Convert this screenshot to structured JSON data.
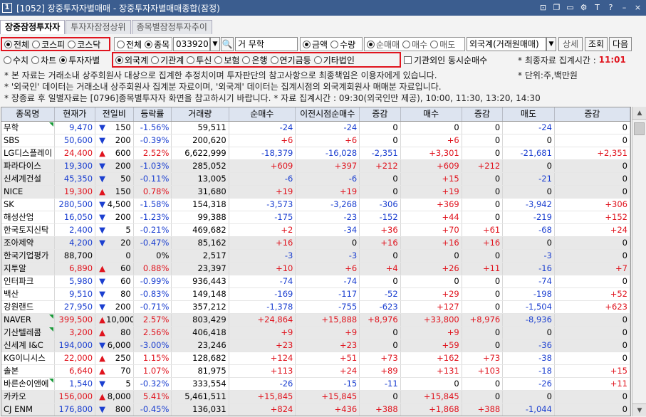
{
  "window": {
    "number": "1",
    "title": "[1052] 장중투자자별매매 - 장중투자자별매매종합(잠정)"
  },
  "tabs": [
    "장중잠정투자자",
    "투자자잠정상위",
    "종목별잠정투자추이"
  ],
  "market_radios": [
    "전체",
    "코스피",
    "코스닥"
  ],
  "scope_radios": [
    "전체",
    "종목"
  ],
  "stock_code": "033920",
  "stock_name_prefix": "거",
  "stock_name": "무학",
  "amount_radios": [
    "금액",
    "수량"
  ],
  "net_radios": [
    "순매매",
    "매수",
    "매도"
  ],
  "investor_select": "외국계(거래원매매)",
  "buttons": {
    "detail": "상세",
    "query": "조회",
    "next": "다음"
  },
  "type_radios": [
    "수치",
    "차트",
    "투자자별"
  ],
  "investor_radios": [
    "외국계",
    "기관계",
    "투신",
    "보험",
    "은행",
    "연기금등",
    "기타법인"
  ],
  "checkbox_label": "기관외인 동시순매수",
  "last_time_label": "* 최종자료 집계시간 :",
  "last_time": "11:01",
  "unit": "* 단위:주,백만원",
  "notes": [
    "* 본 자료는 거래소내 상주회원사 대상으로 집계한 추정치이며 투자판단의 참고사항으로 최종책임은 이용자에게 있습니다.",
    "* '외국인' 데이터는 거래소내 상주회원사 집계분 자료이며, '외국계' 데이터는 집계시점의 외국계회원사 매매분 자료입니다.",
    "* 장종료 후 일별자료는 [0796]종목별투자자 화면을 참고하시기 바랍니다.  * 자료 집계시간 : 09:30(외국인만 제공), 10:00, 11:30, 13:20, 14:30"
  ],
  "columns": [
    "종목명",
    "현재가",
    "전일비",
    "등락률",
    "거래량",
    "순매수",
    "이전시점순매수",
    "증감",
    "매수",
    "증감",
    "매도",
    "증감"
  ],
  "rows": [
    {
      "name": "무학",
      "price": "9,470",
      "dir": "dn",
      "chg": "150",
      "rate": "-1.56%",
      "vol": "59,511",
      "net": "-24",
      "prev": "-24",
      "d1": "0",
      "buy": "0",
      "d2": "0",
      "sell": "-24",
      "d3": "0",
      "mark": true,
      "gray": false
    },
    {
      "name": "SBS",
      "price": "50,600",
      "dir": "dn",
      "chg": "200",
      "rate": "-0.39%",
      "vol": "200,620",
      "net": "+6",
      "prev": "+6",
      "d1": "0",
      "buy": "+6",
      "d2": "0",
      "sell": "0",
      "d3": "0",
      "mark": false,
      "gray": false
    },
    {
      "name": "LG디스플레이",
      "price": "24,400",
      "dir": "up",
      "chg": "600",
      "rate": "2.52%",
      "vol": "6,622,999",
      "net": "-18,379",
      "prev": "-16,028",
      "d1": "-2,351",
      "buy": "+3,301",
      "d2": "0",
      "sell": "-21,681",
      "d3": "+2,351",
      "mark": false,
      "gray": false
    },
    {
      "name": "파라다이스",
      "price": "19,300",
      "dir": "dn",
      "chg": "200",
      "rate": "-1.03%",
      "vol": "285,052",
      "net": "+609",
      "prev": "+397",
      "d1": "+212",
      "buy": "+609",
      "d2": "+212",
      "sell": "0",
      "d3": "0",
      "mark": false,
      "gray": true
    },
    {
      "name": "신세계건설",
      "price": "45,350",
      "dir": "dn",
      "chg": "50",
      "rate": "-0.11%",
      "vol": "13,005",
      "net": "-6",
      "prev": "-6",
      "d1": "0",
      "buy": "+15",
      "d2": "0",
      "sell": "-21",
      "d3": "0",
      "mark": false,
      "gray": true
    },
    {
      "name": "NICE",
      "price": "19,300",
      "dir": "up",
      "chg": "150",
      "rate": "0.78%",
      "vol": "31,680",
      "net": "+19",
      "prev": "+19",
      "d1": "0",
      "buy": "+19",
      "d2": "0",
      "sell": "0",
      "d3": "0",
      "mark": false,
      "gray": true
    },
    {
      "name": "SK",
      "price": "280,500",
      "dir": "dn",
      "chg": "4,500",
      "rate": "-1.58%",
      "vol": "154,318",
      "net": "-3,573",
      "prev": "-3,268",
      "d1": "-306",
      "buy": "+369",
      "d2": "0",
      "sell": "-3,942",
      "d3": "+306",
      "mark": false,
      "gray": false
    },
    {
      "name": "해성산업",
      "price": "16,050",
      "dir": "dn",
      "chg": "200",
      "rate": "-1.23%",
      "vol": "99,388",
      "net": "-175",
      "prev": "-23",
      "d1": "-152",
      "buy": "+44",
      "d2": "0",
      "sell": "-219",
      "d3": "+152",
      "mark": false,
      "gray": false
    },
    {
      "name": "한국토지신탁",
      "price": "2,400",
      "dir": "dn",
      "chg": "5",
      "rate": "-0.21%",
      "vol": "469,682",
      "net": "+2",
      "prev": "-34",
      "d1": "+36",
      "buy": "+70",
      "d2": "+61",
      "sell": "-68",
      "d3": "+24",
      "mark": false,
      "gray": false
    },
    {
      "name": "조아제약",
      "price": "4,200",
      "dir": "dn",
      "chg": "20",
      "rate": "-0.47%",
      "vol": "85,162",
      "net": "+16",
      "prev": "0",
      "d1": "+16",
      "buy": "+16",
      "d2": "+16",
      "sell": "0",
      "d3": "0",
      "mark": false,
      "gray": true
    },
    {
      "name": "한국기업평가",
      "price": "88,700",
      "dir": "",
      "chg": "0",
      "rate": "0%",
      "vol": "2,517",
      "net": "-3",
      "prev": "-3",
      "d1": "0",
      "buy": "0",
      "d2": "0",
      "sell": "-3",
      "d3": "0",
      "mark": false,
      "gray": true
    },
    {
      "name": "지투알",
      "price": "6,890",
      "dir": "up",
      "chg": "60",
      "rate": "0.88%",
      "vol": "23,397",
      "net": "+10",
      "prev": "+6",
      "d1": "+4",
      "buy": "+26",
      "d2": "+11",
      "sell": "-16",
      "d3": "+7",
      "mark": false,
      "gray": true
    },
    {
      "name": "인터파크",
      "price": "5,980",
      "dir": "dn",
      "chg": "60",
      "rate": "-0.99%",
      "vol": "936,443",
      "net": "-74",
      "prev": "-74",
      "d1": "0",
      "buy": "0",
      "d2": "0",
      "sell": "-74",
      "d3": "0",
      "mark": false,
      "gray": false
    },
    {
      "name": "백산",
      "price": "9,510",
      "dir": "dn",
      "chg": "80",
      "rate": "-0.83%",
      "vol": "149,148",
      "net": "-169",
      "prev": "-117",
      "d1": "-52",
      "buy": "+29",
      "d2": "0",
      "sell": "-198",
      "d3": "+52",
      "mark": false,
      "gray": false
    },
    {
      "name": "강원랜드",
      "price": "27,950",
      "dir": "dn",
      "chg": "200",
      "rate": "-0.71%",
      "vol": "357,212",
      "net": "-1,378",
      "prev": "-755",
      "d1": "-623",
      "buy": "+127",
      "d2": "0",
      "sell": "-1,504",
      "d3": "+623",
      "mark": false,
      "gray": false
    },
    {
      "name": "NAVER",
      "price": "399,500",
      "dir": "up",
      "chg": "10,000",
      "rate": "2.57%",
      "vol": "803,429",
      "net": "+24,864",
      "prev": "+15,888",
      "d1": "+8,976",
      "buy": "+33,800",
      "d2": "+8,976",
      "sell": "-8,936",
      "d3": "0",
      "mark": true,
      "gray": true
    },
    {
      "name": "기산텔레콤",
      "price": "3,200",
      "dir": "up",
      "chg": "80",
      "rate": "2.56%",
      "vol": "406,418",
      "net": "+9",
      "prev": "+9",
      "d1": "0",
      "buy": "+9",
      "d2": "0",
      "sell": "0",
      "d3": "0",
      "mark": true,
      "gray": true
    },
    {
      "name": "신세계 I&C",
      "price": "194,000",
      "dir": "dn",
      "chg": "6,000",
      "rate": "-3.00%",
      "vol": "23,246",
      "net": "+23",
      "prev": "+23",
      "d1": "0",
      "buy": "+59",
      "d2": "0",
      "sell": "-36",
      "d3": "0",
      "mark": false,
      "gray": true
    },
    {
      "name": "KG이니시스",
      "price": "22,000",
      "dir": "up",
      "chg": "250",
      "rate": "1.15%",
      "vol": "128,682",
      "net": "+124",
      "prev": "+51",
      "d1": "+73",
      "buy": "+162",
      "d2": "+73",
      "sell": "-38",
      "d3": "0",
      "mark": false,
      "gray": false
    },
    {
      "name": "솔본",
      "price": "6,640",
      "dir": "up",
      "chg": "70",
      "rate": "1.07%",
      "vol": "81,975",
      "net": "+113",
      "prev": "+24",
      "d1": "+89",
      "buy": "+131",
      "d2": "+103",
      "sell": "-18",
      "d3": "+15",
      "mark": false,
      "gray": false
    },
    {
      "name": "바른손이앤에",
      "price": "1,540",
      "dir": "dn",
      "chg": "5",
      "rate": "-0.32%",
      "vol": "333,554",
      "net": "-26",
      "prev": "-15",
      "d1": "-11",
      "buy": "0",
      "d2": "0",
      "sell": "-26",
      "d3": "+11",
      "mark": true,
      "gray": false
    },
    {
      "name": "카카오",
      "price": "156,000",
      "dir": "up",
      "chg": "8,000",
      "rate": "5.41%",
      "vol": "5,461,511",
      "net": "+15,845",
      "prev": "+15,845",
      "d1": "0",
      "buy": "+15,845",
      "d2": "0",
      "sell": "0",
      "d3": "0",
      "mark": false,
      "gray": true
    },
    {
      "name": "CJ ENM",
      "price": "176,800",
      "dir": "dn",
      "chg": "800",
      "rate": "-0.45%",
      "vol": "136,031",
      "net": "+824",
      "prev": "+436",
      "d1": "+388",
      "buy": "+1,868",
      "d2": "+388",
      "sell": "-1,044",
      "d3": "0",
      "mark": false,
      "gray": true
    }
  ],
  "colors": {
    "title_bg": "#3b5d8f",
    "up": "#e0141e",
    "down": "#1b3fd0",
    "highlight": "#e0141e",
    "mark": "#1a9a3a"
  }
}
